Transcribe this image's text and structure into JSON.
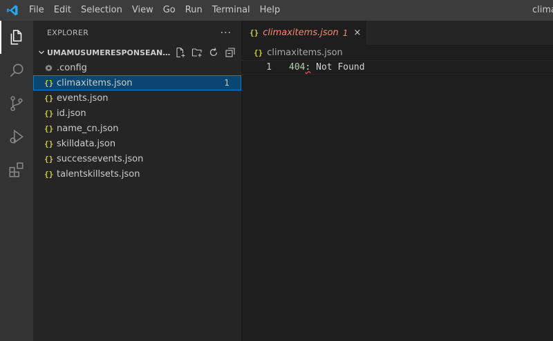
{
  "titlebar": {
    "menu": [
      "File",
      "Edit",
      "Selection",
      "View",
      "Go",
      "Run",
      "Terminal",
      "Help"
    ],
    "window_title": "clima"
  },
  "activitybar": {
    "icons": [
      "explorer-icon",
      "search-icon",
      "source-control-icon",
      "run-debug-icon",
      "extensions-icon"
    ]
  },
  "sidebar": {
    "title": "EXPLORER",
    "more": "···",
    "folder": "UMAMUSUMERESPONSEANALY...",
    "items": [
      {
        "label": ".config",
        "icon": "gear-icon",
        "badge": ""
      },
      {
        "label": "climaxitems.json",
        "icon": "{}",
        "badge": "1"
      },
      {
        "label": "events.json",
        "icon": "{}",
        "badge": ""
      },
      {
        "label": "id.json",
        "icon": "{}",
        "badge": ""
      },
      {
        "label": "name_cn.json",
        "icon": "{}",
        "badge": ""
      },
      {
        "label": "skilldata.json",
        "icon": "{}",
        "badge": ""
      },
      {
        "label": "successevents.json",
        "icon": "{}",
        "badge": ""
      },
      {
        "label": "talentskillsets.json",
        "icon": "{}",
        "badge": ""
      }
    ]
  },
  "editor": {
    "tab": {
      "icon": "{}",
      "label": "climaxitems.json",
      "badge": "1",
      "close": "×"
    },
    "breadcrumb": {
      "icon": "{}",
      "label": "climaxitems.json"
    },
    "lines": [
      {
        "number": "1",
        "num_token": "404",
        "colon": ":",
        "rest": " Not Found"
      }
    ]
  },
  "colors": {
    "accent": "#007fd4",
    "selection": "#094771",
    "error": "#f48771",
    "json_icon": "#cbcb41"
  }
}
